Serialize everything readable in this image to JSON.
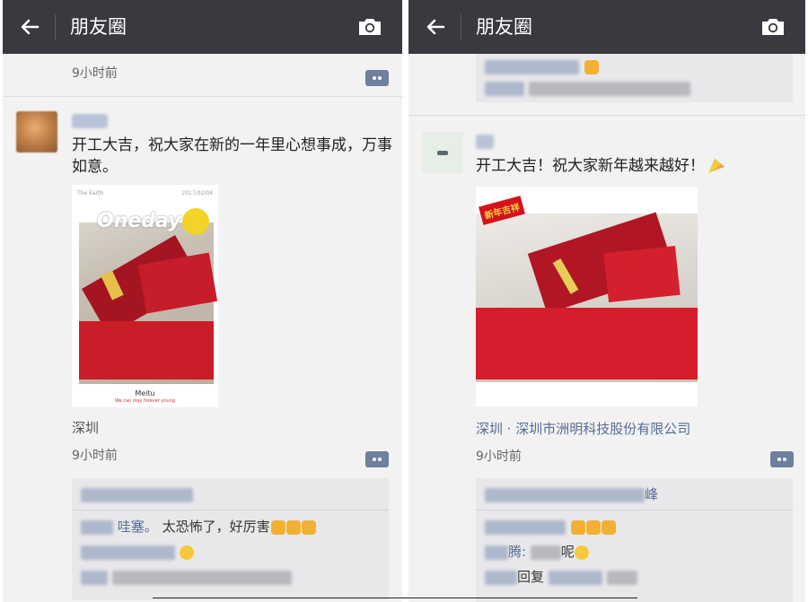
{
  "left": {
    "title": "朋友圈",
    "prev_time": "9小时前",
    "post_text": "开工大吉，祝大家在新的一年里心想事成，万事如意。",
    "photo": {
      "brand": "Oneday",
      "top_left": "The Earth",
      "date": "2017/02/04",
      "footer": "Meitu",
      "footer_sub": "We can stay forever young"
    },
    "location": "深圳",
    "time": "9小时前",
    "comments": {
      "c1_word": "哇塞。",
      "c1_text": "太恐怖了，好厉害"
    }
  },
  "right": {
    "title": "朋友圈",
    "post_text": "开工大吉！祝大家新年越来越好！",
    "photo": {
      "banner": "新年吉祥"
    },
    "location": "深圳 · 深圳市洲明科技股份有限公司",
    "time": "9小时前",
    "comments": {
      "likes_tail": "峰",
      "c2_tail": "腾:",
      "c2_mid": "呢",
      "c3_mid": "回复"
    }
  },
  "colors": {
    "topbar": "#393a3f",
    "link": "#576b95",
    "background": "#f2f2f2",
    "comment_box": "#e8e8ea"
  },
  "icons": [
    "back-arrow-icon",
    "camera-icon",
    "comment-icon",
    "thumbs-up-emoji",
    "smile-emoji",
    "party-popper-emoji"
  ]
}
